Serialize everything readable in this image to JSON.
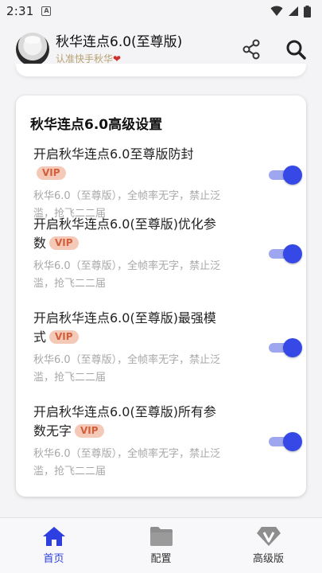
{
  "status_bar": {
    "time": "2:31",
    "app_badge": "A"
  },
  "header": {
    "title": "秋华连点6.0(至尊版)",
    "subtitle": "认准快手秋华",
    "subtitle_heart": "❤"
  },
  "settings_card": {
    "title": "秋华连点6.0高级设置",
    "items": [
      {
        "title": "开启秋华连点6.0至尊版防封",
        "badge": "VIP",
        "desc": "秋华6.0（至尊版），全帧率无字，禁止泛滥，抢飞二二届",
        "enabled": true
      },
      {
        "title": "开启秋华连点6.0(至尊版)优化参数",
        "badge": "VIP",
        "desc": "秋华6.0（至尊版），全帧率无字，禁止泛滥，抢飞二二届",
        "enabled": true
      },
      {
        "title": "开启秋华连点6.0(至尊版)最强模式",
        "badge": "VIP",
        "desc": "秋华6.0（至尊版），全帧率无字，禁止泛滥，抢飞二二届",
        "enabled": true
      },
      {
        "title": "开启秋华连点6.0(至尊版)所有参数无字",
        "badge": "VIP",
        "desc": "秋华6.0（至尊版），全帧率无字，禁止泛滥，抢飞二二届",
        "enabled": true
      }
    ]
  },
  "bottom_nav": {
    "items": [
      {
        "label": "首页",
        "icon": "home-icon",
        "active": true
      },
      {
        "label": "配置",
        "icon": "folder-icon",
        "active": false
      },
      {
        "label": "高级版",
        "icon": "vip-diamond-icon",
        "active": false
      }
    ]
  },
  "colors": {
    "accent": "#2d3fe0",
    "toggle_track": "#9ea6f0",
    "vip_bg": "#f4c9b8",
    "vip_text": "#d25f3b"
  }
}
